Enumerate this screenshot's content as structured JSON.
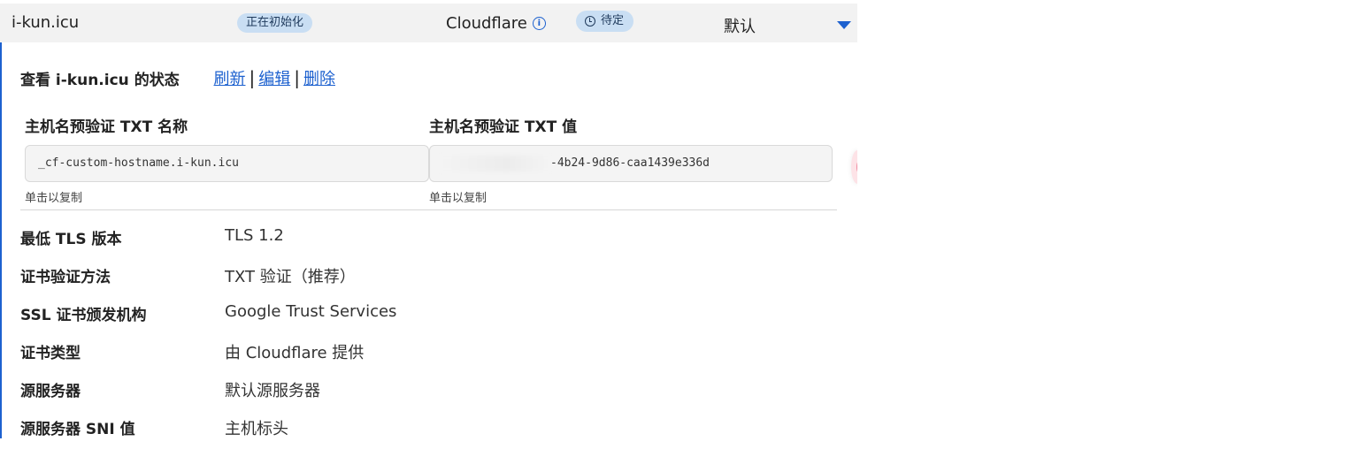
{
  "row": {
    "hostname": "i-kun.icu",
    "certificate_status": "正在初始化",
    "provider": "Cloudflare",
    "hostname_status": "待定",
    "origin": "默认"
  },
  "status_panel": {
    "title": "查看 i-kun.icu 的状态",
    "actions": {
      "refresh": "刷新",
      "edit": "编辑",
      "delete": "删除",
      "separator": "|"
    },
    "txt_name": {
      "label": "主机名预验证 TXT 名称",
      "value": "_cf-custom-hostname.i-kun.icu",
      "hint": "单击以复制"
    },
    "txt_value": {
      "label": "主机名预验证 TXT 值",
      "value": "-4b24-9d86-caa1439e336d",
      "hint": "单击以复制"
    },
    "details": [
      {
        "key": "最低 TLS 版本",
        "value": "TLS 1.2"
      },
      {
        "key": "证书验证方法",
        "value": "TXT 验证（推荐）"
      },
      {
        "key": "SSL 证书颁发机构",
        "value": "Google Trust Services"
      },
      {
        "key": "证书类型",
        "value": "由 Cloudflare 提供"
      },
      {
        "key": "源服务器",
        "value": "默认源服务器"
      },
      {
        "key": "源服务器 SNI 值",
        "value": "主机标头"
      }
    ]
  },
  "icons": {
    "info": "info-icon",
    "clock": "clock-icon",
    "expand": "caret-down-icon"
  },
  "colors": {
    "link": "#1d61cf",
    "pill_bg": "#c9def3",
    "header_bg": "#f2f2f2"
  }
}
